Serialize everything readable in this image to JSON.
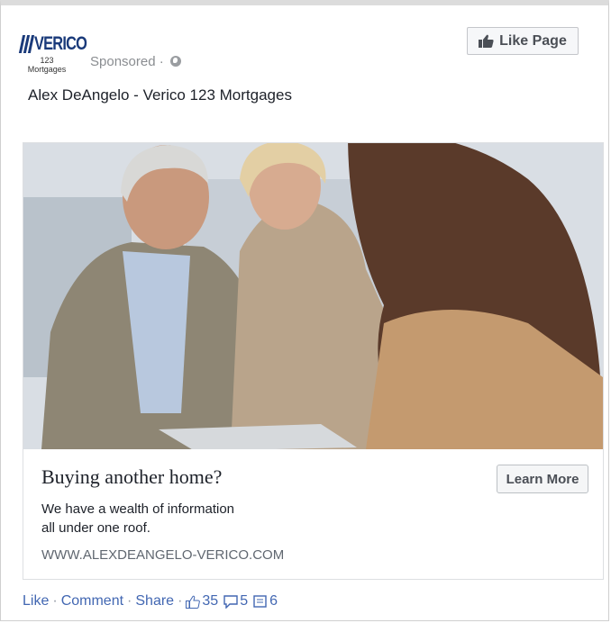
{
  "post": {
    "logo_text": "VERICO",
    "logo_sub_line1": "123",
    "logo_sub_line2": "Mortgages",
    "sponsored_label": "Sponsored · ",
    "like_page_label": "Like Page",
    "page_name": "Alex DeAngelo - Verico 123 Mortgages"
  },
  "ad": {
    "headline": "Buying another home?",
    "description_line1": "We have a wealth of information",
    "description_line2": "all under one roof.",
    "url": "WWW.ALEXDEANGELO-VERICO.COM",
    "cta_label": "Learn More"
  },
  "actions": {
    "like_label": "Like",
    "comment_label": "Comment",
    "share_label": "Share",
    "likes_count": "35",
    "comments_count": "5",
    "shares_count": "6"
  },
  "colors": {
    "brand_navy": "#1a3a7a",
    "link_blue": "#4267b2",
    "muted_gray": "#8a8d91"
  }
}
